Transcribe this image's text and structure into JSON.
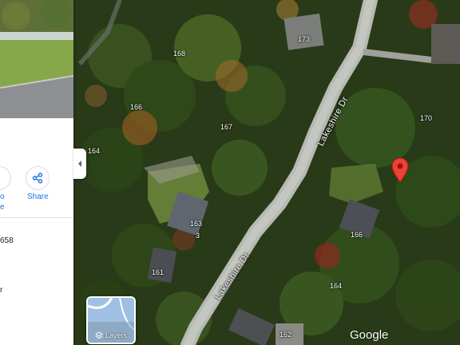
{
  "map": {
    "road_labels": {
      "lakeshire_dr_upper": "Lakeshire Dr",
      "lakeshire_dr_lower": "Lakeshire Dr"
    },
    "house_numbers": [
      "173",
      "168",
      "166",
      "167",
      "164",
      "170",
      "163",
      "3",
      "166",
      "161",
      "164",
      "162"
    ],
    "pin_color": "#ea4335",
    "attribution": "Google",
    "layers_label": "Layers"
  },
  "panel": {
    "share_label": "Share",
    "partial_action_label_line1": "o",
    "partial_action_label_line2": "e",
    "partial_text_1": "658",
    "partial_text_2": "r"
  }
}
